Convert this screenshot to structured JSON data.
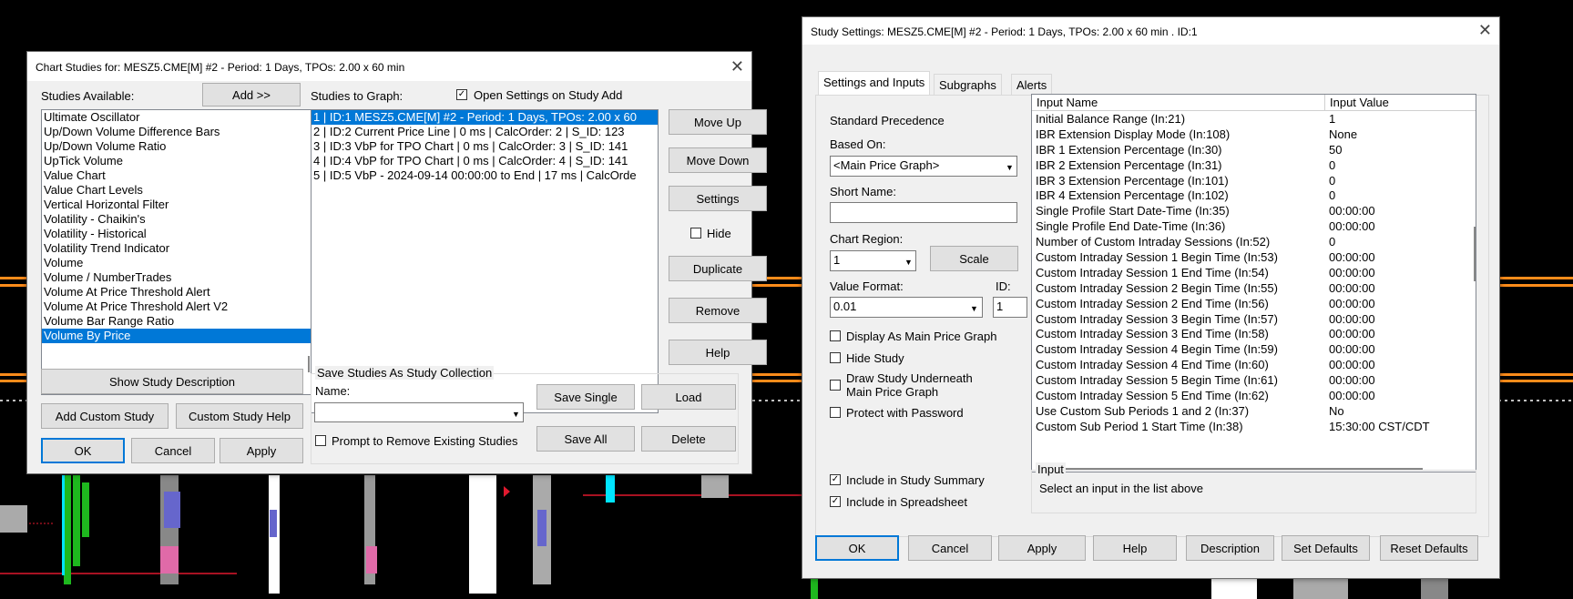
{
  "colors": {
    "accent": "#0078d7",
    "chart_green": "#1eb81e",
    "chart_orange": "#ff8c1a",
    "chart_red": "#e0192e",
    "chart_cyan": "#00e5ff",
    "chart_blue": "#6666cc",
    "chart_pink": "#e06aa8"
  },
  "chart_studies": {
    "title": "Chart Studies for: MESZ5.CME[M] #2 - Period: 1 Days, TPOs: 2.00 x 60 min",
    "studies_available_label": "Studies Available:",
    "add_label": "Add >>",
    "studies_available": [
      "Ultimate Oscillator",
      "Up/Down Volume Difference Bars",
      "Up/Down Volume Ratio",
      "UpTick Volume",
      "Value Chart",
      "Value Chart Levels",
      "Vertical Horizontal Filter",
      "Volatility - Chaikin's",
      "Volatility - Historical",
      "Volatility Trend Indicator",
      "Volume",
      "Volume / NumberTrades",
      "Volume At Price Threshold Alert",
      "Volume At Price Threshold Alert V2",
      "Volume Bar Range Ratio",
      "Volume By Price"
    ],
    "studies_to_graph_label": "Studies to Graph:",
    "open_settings_label": "Open Settings on Study Add",
    "studies_to_graph": [
      "1 | ID:1  MESZ5.CME[M] #2 - Period: 1 Days, TPOs: 2.00 x 60",
      "2 | ID:2  Current Price Line | 0 ms | CalcOrder: 2 | S_ID: 123",
      "3 | ID:3  VbP for TPO Chart | 0 ms | CalcOrder: 3 | S_ID: 141",
      "4 | ID:4  VbP for TPO Chart | 0 ms | CalcOrder: 4 | S_ID: 141",
      "5 | ID:5  VbP - 2024-09-14  00:00:00 to End | 17 ms | CalcOrde"
    ],
    "move_up": "Move Up",
    "move_down": "Move Down",
    "settings": "Settings",
    "hide": "Hide",
    "duplicate": "Duplicate",
    "remove": "Remove",
    "help": "Help",
    "show_description": "Show Study Description",
    "add_custom": "Add Custom Study",
    "custom_help": "Custom Study Help",
    "ok": "OK",
    "cancel": "Cancel",
    "apply": "Apply",
    "save_collection_title": "Save Studies As Study Collection",
    "name_label": "Name:",
    "name_value": "",
    "save_single": "Save Single",
    "load": "Load",
    "prompt_remove": "Prompt to Remove Existing Studies",
    "save_all": "Save All",
    "delete": "Delete"
  },
  "study_settings": {
    "title": "Study Settings: MESZ5.CME[M] #2 - Period: 1 Days, TPOs: 2.00 x 60 min  . ID:1",
    "tabs": [
      "Settings and Inputs",
      "Subgraphs",
      "Alerts"
    ],
    "standard_precedence": "Standard Precedence",
    "based_on_label": "Based On:",
    "based_on_value": "<Main Price Graph>",
    "short_name_label": "Short Name:",
    "short_name_value": "",
    "chart_region_label": "Chart Region:",
    "chart_region_value": "1",
    "scale_label": "Scale",
    "value_format_label": "Value Format:",
    "value_format_value": "0.01",
    "id_label": "ID:",
    "id_value": "1",
    "display_main": "Display As Main Price Graph",
    "hide_study": "Hide Study",
    "draw_underneath_1": "Draw Study Underneath",
    "draw_underneath_2": "Main Price Graph",
    "protect_password": "Protect with Password",
    "include_summary": "Include in Study Summary",
    "include_spreadsheet": "Include in Spreadsheet",
    "col_input_name": "Input Name",
    "col_input_value": "Input Value",
    "inputs": [
      {
        "name": "Initial Balance Range  (In:21)",
        "value": "1"
      },
      {
        "name": "IBR Extension Display Mode  (In:108)",
        "value": "None"
      },
      {
        "name": "IBR 1 Extension Percentage  (In:30)",
        "value": "50"
      },
      {
        "name": "IBR 2 Extension Percentage  (In:31)",
        "value": "0"
      },
      {
        "name": "IBR 3 Extension Percentage  (In:101)",
        "value": "0"
      },
      {
        "name": "IBR 4 Extension Percentage  (In:102)",
        "value": "0"
      },
      {
        "name": "Single Profile Start Date-Time  (In:35)",
        "value": "00:00:00"
      },
      {
        "name": "Single Profile End Date-Time  (In:36)",
        "value": "00:00:00"
      },
      {
        "name": "Number of Custom Intraday Sessions  (In:52)",
        "value": "0"
      },
      {
        "name": "Custom Intraday Session 1 Begin Time  (In:53)",
        "value": "00:00:00"
      },
      {
        "name": "Custom Intraday Session 1 End Time  (In:54)",
        "value": "00:00:00"
      },
      {
        "name": "Custom Intraday Session 2 Begin Time  (In:55)",
        "value": "00:00:00"
      },
      {
        "name": "Custom Intraday Session 2 End Time  (In:56)",
        "value": "00:00:00"
      },
      {
        "name": "Custom Intraday Session 3 Begin Time  (In:57)",
        "value": "00:00:00"
      },
      {
        "name": "Custom Intraday Session 3 End Time  (In:58)",
        "value": "00:00:00"
      },
      {
        "name": "Custom Intraday Session 4 Begin Time  (In:59)",
        "value": "00:00:00"
      },
      {
        "name": "Custom Intraday Session 4 End Time  (In:60)",
        "value": "00:00:00"
      },
      {
        "name": "Custom Intraday Session 5 Begin Time  (In:61)",
        "value": "00:00:00"
      },
      {
        "name": "Custom Intraday Session 5 End Time  (In:62)",
        "value": "00:00:00"
      },
      {
        "name": "Use Custom Sub Periods 1 and 2  (In:37)",
        "value": "No"
      },
      {
        "name": "Custom Sub Period 1 Start Time  (In:38)",
        "value": "15:30:00 CST/CDT"
      }
    ],
    "input_group_title": "Input",
    "input_hint": "Select an input in the list above",
    "ok": "OK",
    "cancel": "Cancel",
    "apply": "Apply",
    "help": "Help",
    "description": "Description",
    "set_defaults": "Set Defaults",
    "reset_defaults": "Reset Defaults"
  }
}
